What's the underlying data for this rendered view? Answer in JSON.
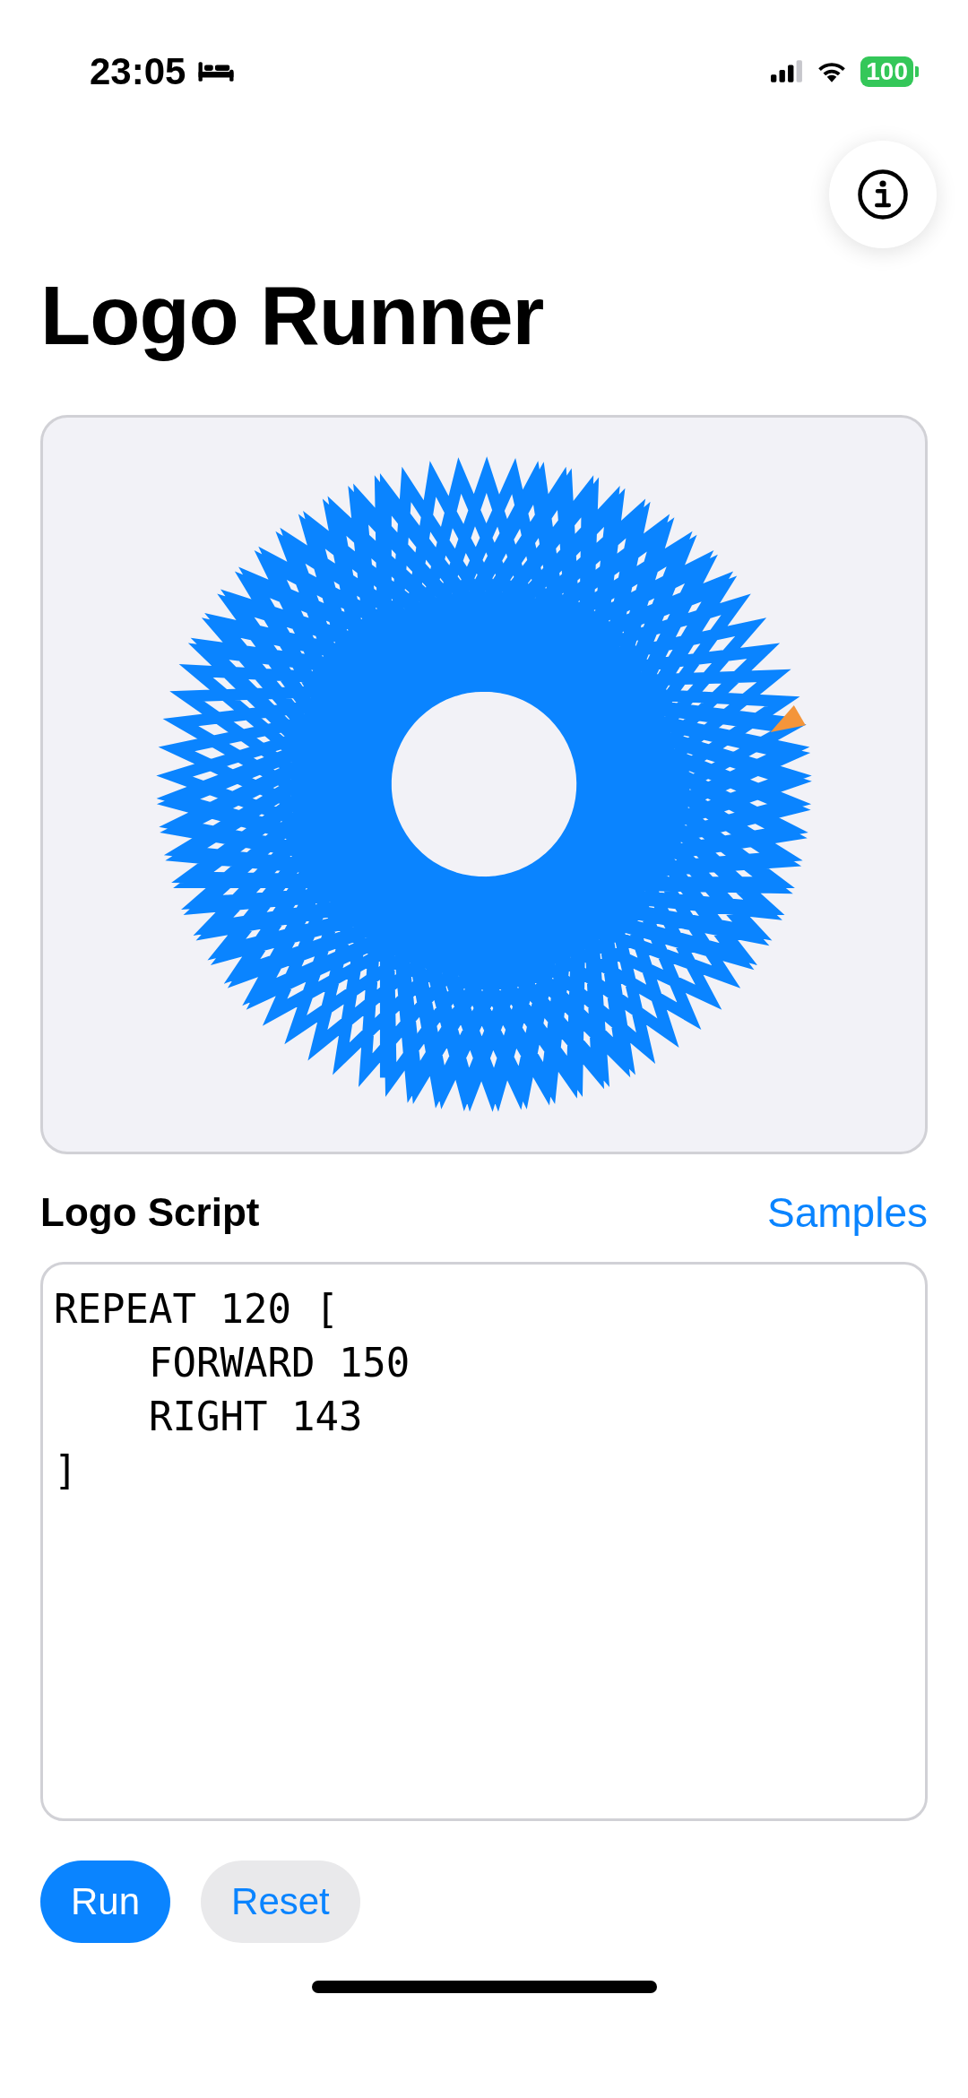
{
  "status_bar": {
    "time": "23:05",
    "battery": "100"
  },
  "title": "Logo Runner",
  "script_section": {
    "label": "Logo Script",
    "link": "Samples"
  },
  "editor": {
    "value": "REPEAT 120 [\n    FORWARD 150\n    RIGHT 143\n]"
  },
  "buttons": [
    {
      "label": "Run",
      "kind": "primary"
    },
    {
      "label": "Reset",
      "kind": "secondary"
    }
  ]
}
